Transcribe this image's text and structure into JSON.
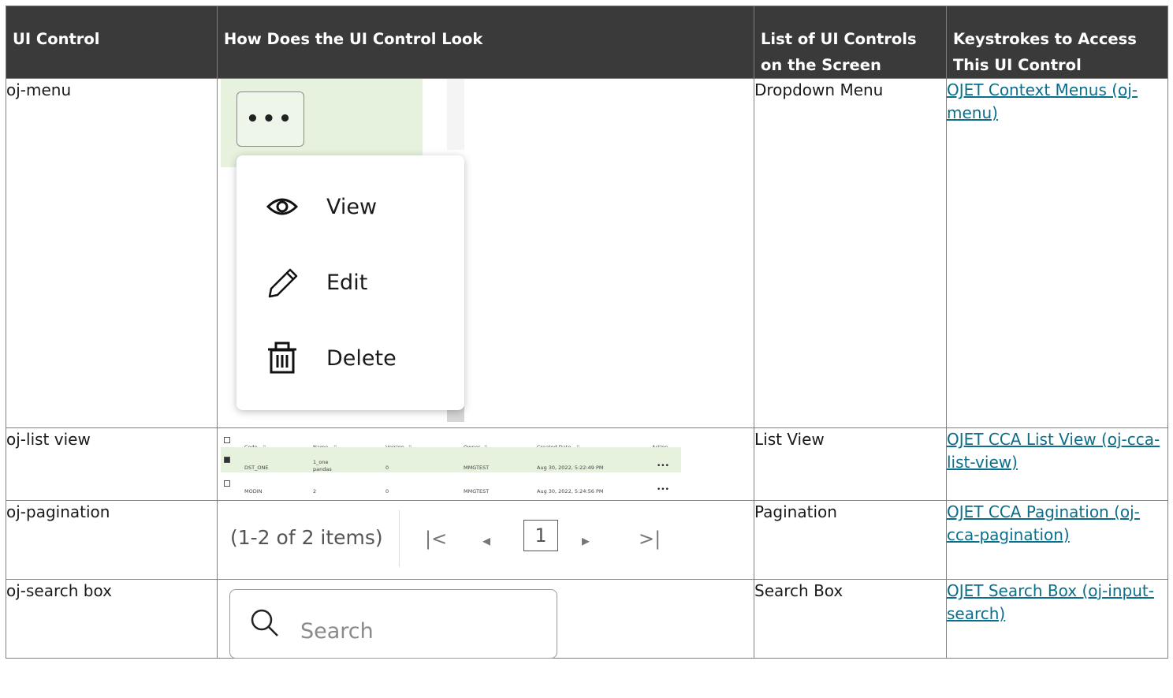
{
  "headers": {
    "col1": "UI Control",
    "col2": "How Does the UI Control Look",
    "col3": "List of UI Controls on the Screen",
    "col4": "Keystrokes to Access This UI Control"
  },
  "rows": [
    {
      "control": "oj-menu",
      "list": "Dropdown Menu",
      "link": "OJET Context Menus (oj-menu)"
    },
    {
      "control": "oj-list view",
      "list": "List View",
      "link": "OJET CCA List View (oj-cca-list-view)"
    },
    {
      "control": "oj-pagination",
      "list": "Pagination",
      "link": "OJET CCA Pagination (oj-cca-pagination)"
    },
    {
      "control": "oj-search box",
      "list": "Search Box",
      "link": "OJET Search Box (oj-input-search)"
    }
  ],
  "menu_preview": {
    "button_label": "•••",
    "items": [
      {
        "label": "View",
        "icon": "eye-icon"
      },
      {
        "label": "Edit",
        "icon": "pencil-icon"
      },
      {
        "label": "Delete",
        "icon": "trash-icon"
      }
    ]
  },
  "listview_preview": {
    "columns": [
      "Code",
      "Name",
      "Version",
      "Owner",
      "Created Date",
      "Action"
    ],
    "rows": [
      {
        "code": "DST_ONE",
        "name1": "1_one",
        "name2": "pandas",
        "version": "0",
        "owner": "MMGTEST",
        "created": "Aug 30, 2022, 5:22:49 PM",
        "action": "•••",
        "selected": true
      },
      {
        "code": "MODIN",
        "name1": "2",
        "name2": "",
        "version": "0",
        "owner": "MMGTEST",
        "created": "Aug 30, 2022, 5:24:56 PM",
        "action": "•••",
        "selected": false
      }
    ]
  },
  "pagination_preview": {
    "info": "(1-2 of 2 items)",
    "first": "|<",
    "prev": "◂",
    "page": "1",
    "next": "▸",
    "last": ">|"
  },
  "search_preview": {
    "placeholder": "Search"
  }
}
